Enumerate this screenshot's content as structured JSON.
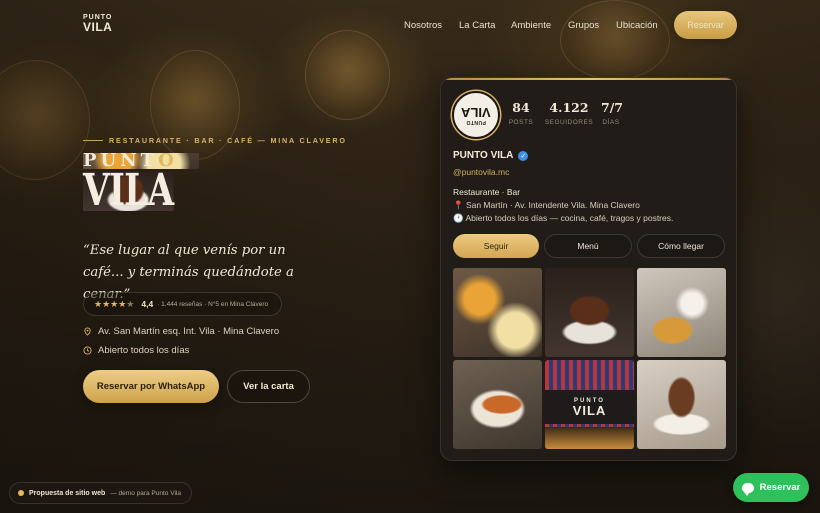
{
  "header": {
    "logo_top": "PUNTO",
    "logo_bottom": "VILA",
    "nav": [
      "Nosotros",
      "La Carta",
      "Ambiente",
      "Grupos",
      "Ubicación"
    ],
    "reservar_label": "Reservar"
  },
  "hero": {
    "kicker": "RESTAURANTE · BAR · CAFÉ — MINA CLAVERO",
    "title_top_main": "PUNT",
    "title_top_accent": "O",
    "title_bottom": "VILA",
    "quote": "“Ese lugar al que venís por un café... y terminás quedándote a cenar.”",
    "rating_value": "4,4",
    "rating_stars": 4,
    "rating_sub": "· 1.444 reseñas · N°5 en Mina Clavero",
    "address": "Av. San Martín esq. Int. Vila · Mina Clavero",
    "hours": "Abierto todos los días",
    "whatsapp_label": "Reservar por WhatsApp",
    "menu_label": "Ver la carta"
  },
  "profile": {
    "avatar_top": "VILA",
    "avatar_bottom": "PUNTO",
    "stats": [
      {
        "value": "84",
        "label": "POSTS"
      },
      {
        "value": "4.122",
        "label": "SEGUIDORES"
      },
      {
        "value": "7/7",
        "label": "DÍAS"
      }
    ],
    "name": "PUNTO VILA",
    "verified_glyph": "✓",
    "username": "@puntovila.mc",
    "bio": [
      "Restaurante · Bar",
      "📍 San Martín · Av. Intendente Vila. Mina Clavero",
      "🕐 Abierto todos los días — cocina, café, tragos y postres."
    ],
    "buttons": [
      "Seguir",
      "Menú",
      "Cómo llegar"
    ],
    "tile_sign_top": "PUNTO",
    "tile_sign_bottom": "VILA"
  },
  "footer": {
    "proposal_strong": "Propuesta de sitio web",
    "proposal_muted": "— demo para Punto Vila",
    "float_reservar": "Reservar"
  },
  "colors": {
    "accent_gold": "#e2b95e",
    "whatsapp_green": "#2fbf5b",
    "verified_blue": "#3d8ee6"
  }
}
